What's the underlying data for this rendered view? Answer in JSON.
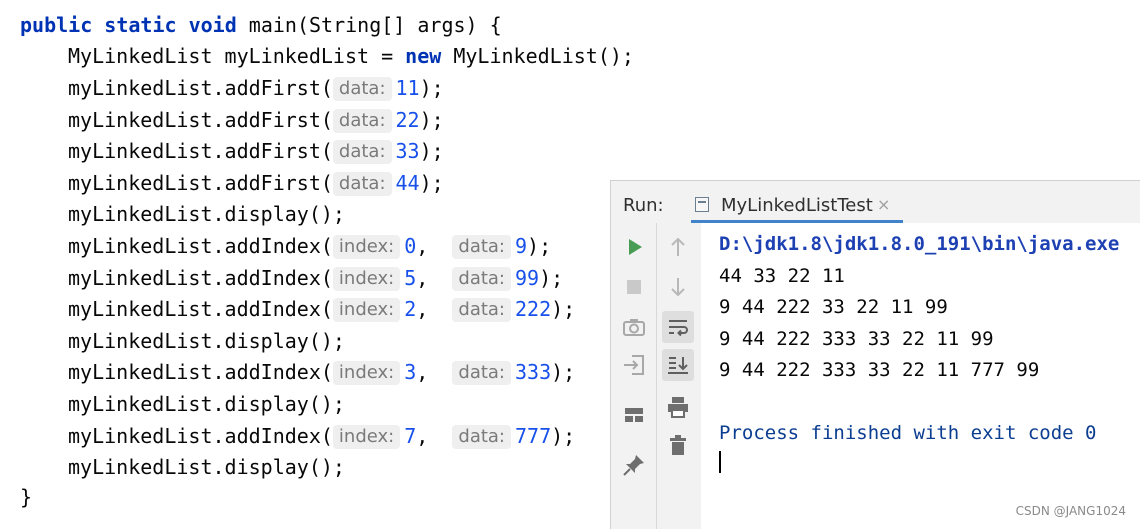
{
  "editor": {
    "method_signature": {
      "public": "public",
      "static": "static",
      "void": "void",
      "rest": " main(String[] args) {"
    },
    "new_line": {
      "decl": "MyLinkedList myLinkedList = ",
      "new_kw": "new",
      "ctor": " MyLinkedList();"
    },
    "calls": [
      {
        "call": "myLinkedList.addFirst(",
        "hints": [
          {
            "label": "data:",
            "value": "11"
          }
        ],
        "end": ");"
      },
      {
        "call": "myLinkedList.addFirst(",
        "hints": [
          {
            "label": "data:",
            "value": "22"
          }
        ],
        "end": ");"
      },
      {
        "call": "myLinkedList.addFirst(",
        "hints": [
          {
            "label": "data:",
            "value": "33"
          }
        ],
        "end": ");"
      },
      {
        "call": "myLinkedList.addFirst(",
        "hints": [
          {
            "label": "data:",
            "value": "44"
          }
        ],
        "end": ");"
      },
      {
        "call": "myLinkedList.display();"
      },
      {
        "call": "myLinkedList.addIndex(",
        "hints": [
          {
            "label": "index:",
            "value": "0"
          },
          {
            "label": "data:",
            "value": "9"
          }
        ],
        "end": ");"
      },
      {
        "call": "myLinkedList.addIndex(",
        "hints": [
          {
            "label": "index:",
            "value": "5"
          },
          {
            "label": "data:",
            "value": "99"
          }
        ],
        "end": ");"
      },
      {
        "call": "myLinkedList.addIndex(",
        "hints": [
          {
            "label": "index:",
            "value": "2"
          },
          {
            "label": "data:",
            "value": "222"
          }
        ],
        "end": ");"
      },
      {
        "call": "myLinkedList.display();"
      },
      {
        "call": "myLinkedList.addIndex(",
        "hints": [
          {
            "label": "index:",
            "value": "3"
          },
          {
            "label": "data:",
            "value": "333"
          }
        ],
        "end": ");"
      },
      {
        "call": "myLinkedList.display();"
      },
      {
        "call": "myLinkedList.addIndex(",
        "hints": [
          {
            "label": "index:",
            "value": "7"
          },
          {
            "label": "data:",
            "value": "777"
          }
        ],
        "end": ");"
      },
      {
        "call": "myLinkedList.display();"
      }
    ],
    "closing_brace": "}"
  },
  "run_panel": {
    "label": "Run:",
    "tab_title": "MyLinkedListTest",
    "tab_close": "×",
    "toolbar_left": [
      "run-icon",
      "stop-icon",
      "camera-icon",
      "login-icon",
      "layout-icon",
      "pin-icon"
    ],
    "toolbar_right": [
      "up-arrow-icon",
      "down-arrow-icon",
      "soft-wrap-icon",
      "scroll-to-end-icon",
      "print-icon",
      "trash-icon"
    ],
    "console": {
      "command": "D:\\jdk1.8\\jdk1.8.0_191\\bin\\java.exe",
      "output": [
        "44 33 22 11",
        "9 44 222 33 22 11 99",
        "9 44 222 333 33 22 11 99",
        "9 44 222 333 33 22 11 777 99"
      ],
      "exit_message": "Process finished with exit code 0"
    }
  },
  "watermark": "CSDN @JANG1024",
  "colors": {
    "keyword": "#0033b3",
    "number": "#1750eb",
    "run_green": "#499c54",
    "tab_accent": "#4083c9"
  }
}
